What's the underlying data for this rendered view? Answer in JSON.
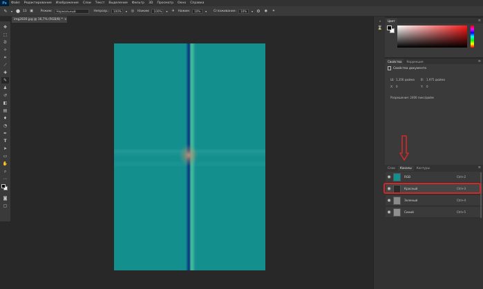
{
  "menubar": {
    "logo": "Ps",
    "items": [
      "Файл",
      "Редактирование",
      "Изображение",
      "Слои",
      "Текст",
      "Выделение",
      "Фильтр",
      "3D",
      "Просмотр",
      "Окно",
      "Справка"
    ]
  },
  "options": {
    "brush_size": "13",
    "mode_label": "Режим:",
    "mode_value": "Нормальный",
    "opacity_label": "Непрозр.:",
    "opacity_value": "100%",
    "flow_label": "Нажим:",
    "flow_value": "100%",
    "smoothing_label": "Нажим:",
    "smoothing_value": "10%",
    "smooth_label": "Сглаживание:",
    "smooth_value": "10%"
  },
  "document": {
    "tab_title": "img2830.jpg @ 16,7% (RGB/8) *",
    "tab_close": "×"
  },
  "color_panel": {
    "tab": "Цвет"
  },
  "properties_panel": {
    "tabs": [
      "Свойства",
      "Коррекция"
    ],
    "title": "Свойства документа",
    "w_label": "Ш:",
    "w_value": "1,356 дюйма",
    "h_label": "В:",
    "h_value": "1,975 дюйма",
    "x_label": "X:",
    "x_value": "0",
    "y_label": "Y:",
    "y_value": "0",
    "resolution": "Разрешение: 2400 пикс/дюйм"
  },
  "channels_panel": {
    "tabs": [
      "Слои",
      "Каналы",
      "Контуры"
    ],
    "channels": [
      {
        "name": "RGB",
        "shortcut": "Ctrl+2",
        "thumb_color": "#148f8f"
      },
      {
        "name": "Красный",
        "shortcut": "Ctrl+3",
        "thumb_color": "#2a2a2a"
      },
      {
        "name": "Зеленый",
        "shortcut": "Ctrl+4",
        "thumb_color": "#8a8a8a"
      },
      {
        "name": "Синий",
        "shortcut": "Ctrl+5",
        "thumb_color": "#8f8f8f"
      }
    ]
  },
  "colors": {
    "accent_red": "#d42828",
    "image_teal": "#138f8e"
  },
  "icons": [
    "move-icon",
    "marquee-icon",
    "lasso-icon",
    "magic-wand-icon",
    "crop-icon",
    "eyedropper-icon",
    "healing-icon",
    "brush-icon",
    "stamp-icon",
    "history-brush-icon",
    "eraser-icon",
    "gradient-icon",
    "blur-icon",
    "dodge-icon",
    "pen-icon",
    "type-icon",
    "path-select-icon",
    "rectangle-icon",
    "hand-icon",
    "zoom-icon",
    "more-icon",
    "eye-icon"
  ]
}
